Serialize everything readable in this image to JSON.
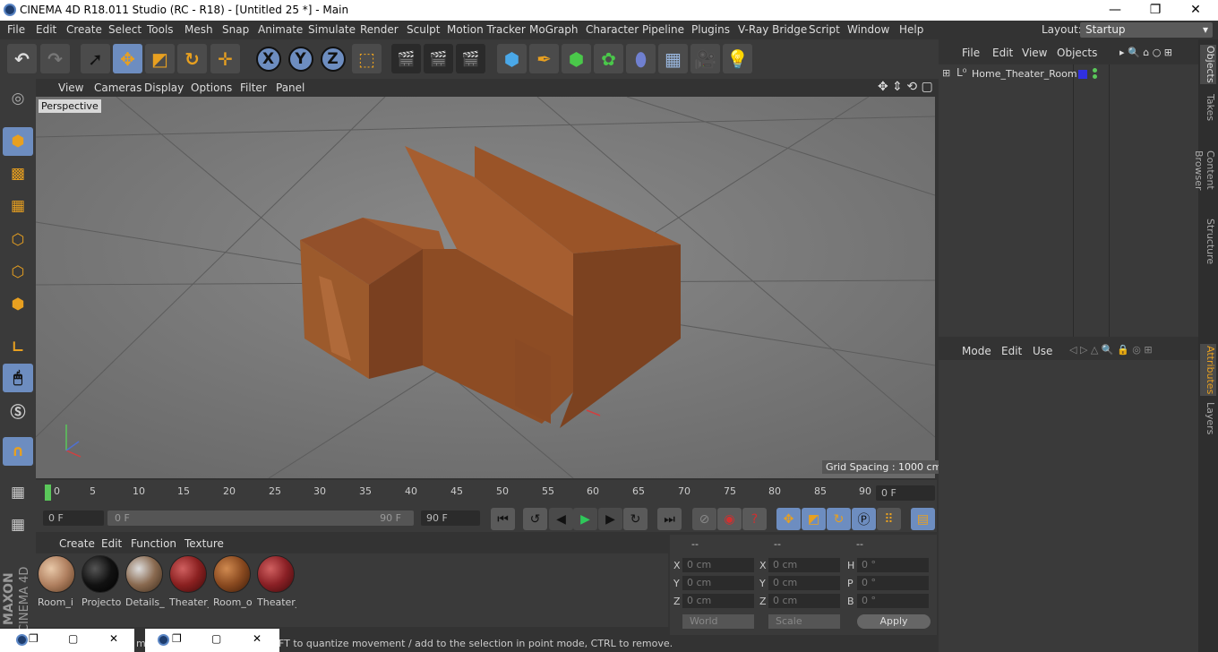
{
  "window": {
    "title": "CINEMA 4D R18.011 Studio (RC - R18) - [Untitled 25 *] - Main",
    "minimize": "—",
    "maximize": "❐",
    "close": "✕"
  },
  "menubar": [
    "File",
    "Edit",
    "Create",
    "Select",
    "Tools",
    "Mesh",
    "Snap",
    "Animate",
    "Simulate",
    "Render",
    "Sculpt",
    "Motion Tracker",
    "MoGraph",
    "Character",
    "Pipeline",
    "Plugins",
    "V-Ray Bridge",
    "Script",
    "Window",
    "Help"
  ],
  "layout": {
    "label": "Layout:",
    "value": "Startup"
  },
  "viewport": {
    "menu": [
      "View",
      "Cameras",
      "Display",
      "Options",
      "Filter",
      "Panel"
    ],
    "camera_label": "Perspective",
    "grid_spacing": "Grid Spacing : 1000 cm"
  },
  "timeline": {
    "ticks": [
      "0",
      "5",
      "10",
      "15",
      "20",
      "25",
      "30",
      "35",
      "40",
      "45",
      "50",
      "55",
      "60",
      "65",
      "70",
      "75",
      "80",
      "85",
      "90"
    ],
    "current_frame": "0 F"
  },
  "playback": {
    "start_field": "0 F",
    "range_start": "0 F",
    "range_end": "90 F",
    "end_field": "90 F"
  },
  "material_manager": {
    "menu": [
      "Create",
      "Edit",
      "Function",
      "Texture"
    ],
    "materials": [
      {
        "name": "Room_i",
        "color": "#b08060"
      },
      {
        "name": "Projecto",
        "color": "#111111"
      },
      {
        "name": "Details_",
        "color": "#8a6a50"
      },
      {
        "name": "Theater_",
        "color": "#8a2020"
      },
      {
        "name": "Room_o",
        "color": "#8a4a20"
      },
      {
        "name": "Theater_",
        "color": "#8a2025"
      }
    ]
  },
  "coordinates": {
    "headers": [
      "--",
      "--",
      "--"
    ],
    "rows": [
      {
        "a": "X",
        "av": "0 cm",
        "b": "X",
        "bv": "0 cm",
        "c": "H",
        "cv": "0 °"
      },
      {
        "a": "Y",
        "av": "0 cm",
        "b": "Y",
        "bv": "0 cm",
        "c": "P",
        "cv": "0 °"
      },
      {
        "a": "Z",
        "av": "0 cm",
        "b": "Z",
        "bv": "0 cm",
        "c": "B",
        "cv": "0 °"
      }
    ],
    "world": "World",
    "scale": "Scale",
    "apply": "Apply"
  },
  "object_manager": {
    "menu": [
      "File",
      "Edit",
      "View",
      "Objects"
    ],
    "objects": [
      {
        "name": "Home_Theater_Room"
      }
    ]
  },
  "attribute_manager": {
    "menu": [
      "Mode",
      "Edit",
      "Use"
    ]
  },
  "side_tabs_top": [
    "Objects",
    "Takes",
    "Content Browser",
    "Structure"
  ],
  "side_tabs_bottom": [
    "Attributes",
    "Layers"
  ],
  "status": "FT to quantize movement / add to the selection in point mode, CTRL to remove.",
  "status_prefix": "mo",
  "brand": {
    "line1": "MAXON",
    "line2": "CINEMA 4D"
  },
  "colors": {
    "accent": "#6d8dc0",
    "model": "#8a4a20"
  }
}
